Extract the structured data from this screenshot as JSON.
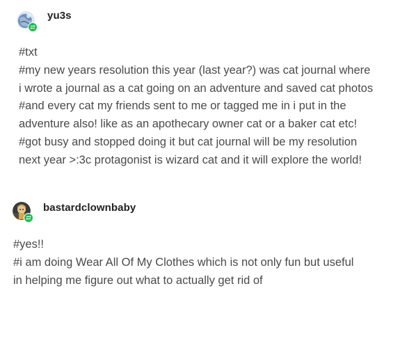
{
  "posts": [
    {
      "username": "yu3s",
      "avatar": "globe-avatar",
      "badge_icon": "reblog-icon",
      "lines": [
        "#txt",
        "#my new years resolution this year (last year?) was cat journal where",
        "i wrote a journal as a cat going on an adventure and saved cat photos",
        "#and every cat my friends sent to me or tagged me in i put in the",
        "adventure also! like as an apothecary owner cat or a baker cat etc!",
        "#got busy and stopped doing it but cat journal will be my resolution",
        "next year >:3c protagonist is wizard cat and it will explore the world!"
      ]
    },
    {
      "username": "bastardclownbaby",
      "avatar": "character-avatar",
      "badge_icon": "reblog-icon",
      "lines": [
        "#yes!!",
        "#i am doing Wear All Of My Clothes which is not only fun but useful",
        "in helping me figure out what to actually get rid of"
      ]
    }
  ],
  "colors": {
    "badge": "#1fbf4e",
    "username": "#222222",
    "text": "#4a4a4a"
  }
}
